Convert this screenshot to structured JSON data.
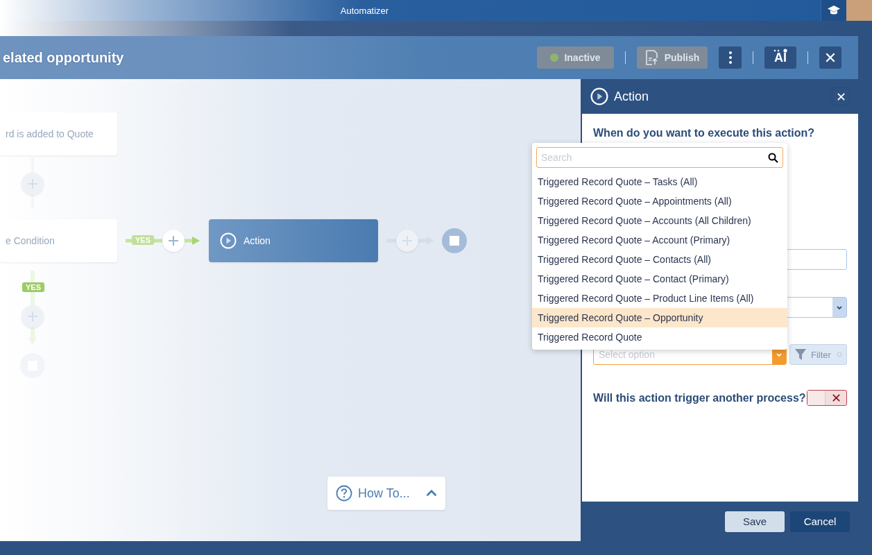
{
  "app_bar": {
    "title": "Automatizer"
  },
  "process": {
    "title": "elated opportunity",
    "status": {
      "label": "Inactive",
      "disabled": true
    },
    "publish": {
      "label": "Publish",
      "disabled": true
    },
    "ai_button": "AI"
  },
  "canvas": {
    "nodes": [
      {
        "kind": "trigger",
        "label": "rd is added to Quote"
      },
      {
        "kind": "condition",
        "label": "e Condition"
      },
      {
        "kind": "action",
        "label": "Action"
      }
    ],
    "branch_labels": [
      "YES",
      "YES"
    ]
  },
  "how_to": {
    "label": "How To...",
    "expanded": false
  },
  "panel": {
    "title": "Action",
    "question": "When do you want to execute this action?",
    "select_placeholder": "Select option",
    "filter": "Filter",
    "trigger_question": "Will this action trigger another process?",
    "trigger_on": false,
    "save": "Save",
    "cancel": "Cancel"
  },
  "dropdown": {
    "placeholder": "Search",
    "options": [
      {
        "label": "Triggered Record Quote – Tasks (All)",
        "selected": false
      },
      {
        "label": "Triggered Record Quote – Appointments (All)",
        "selected": false
      },
      {
        "label": "Triggered Record Quote – Accounts (All Children)",
        "selected": false
      },
      {
        "label": "Triggered Record Quote – Account (Primary)",
        "selected": false
      },
      {
        "label": "Triggered Record Quote – Contacts (All)",
        "selected": false
      },
      {
        "label": "Triggered Record Quote – Contact (Primary)",
        "selected": false
      },
      {
        "label": "Triggered Record Quote – Product Line Items (All)",
        "selected": false
      },
      {
        "label": "Triggered Record Quote – Opportunity",
        "selected": true
      },
      {
        "label": "Triggered Record Quote",
        "selected": false
      }
    ]
  }
}
